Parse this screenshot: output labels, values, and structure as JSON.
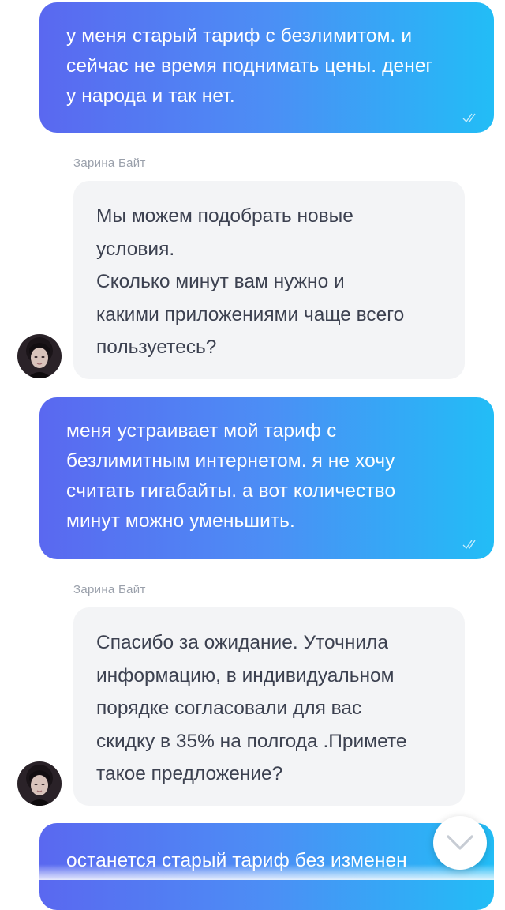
{
  "messages": [
    {
      "type": "outgoing",
      "text": "у меня старый тариф с безлимитом. и\nсейчас не время поднимать цены. денег\nу народа и так нет."
    },
    {
      "type": "incoming",
      "sender": "Зарина Байт",
      "text": "Мы можем подобрать новые\nусловия.\nСколько минут вам нужно и\nкакими приложениями чаще всего\nпользуетесь?"
    },
    {
      "type": "outgoing",
      "text": "меня устраивает мой тариф с\nбезлимитным интернетом. я не хочу\nсчитать гигабайты. а вот количество\nминут можно уменьшить."
    },
    {
      "type": "incoming",
      "sender": "Зарина Байт",
      "text": "Спасибо за ожидание. Уточнила\nинформацию, в индивидуальном\nпорядке согласовали для вас\nскидку в 35% на полгода .Примете\nтакое предложение?"
    },
    {
      "type": "outgoing",
      "text": "останется старый тариф без изменен"
    }
  ],
  "icons": {
    "read_receipt": "double-check-icon",
    "scroll_down": "chevron-down-icon",
    "avatar": "agent-avatar"
  },
  "colors": {
    "outgoing_gradient_start": "#5a68f0",
    "outgoing_gradient_end": "#22bdf6",
    "incoming_bg": "#f3f4f6",
    "incoming_text": "#3c4150",
    "sender_name": "#9aa0ab"
  }
}
